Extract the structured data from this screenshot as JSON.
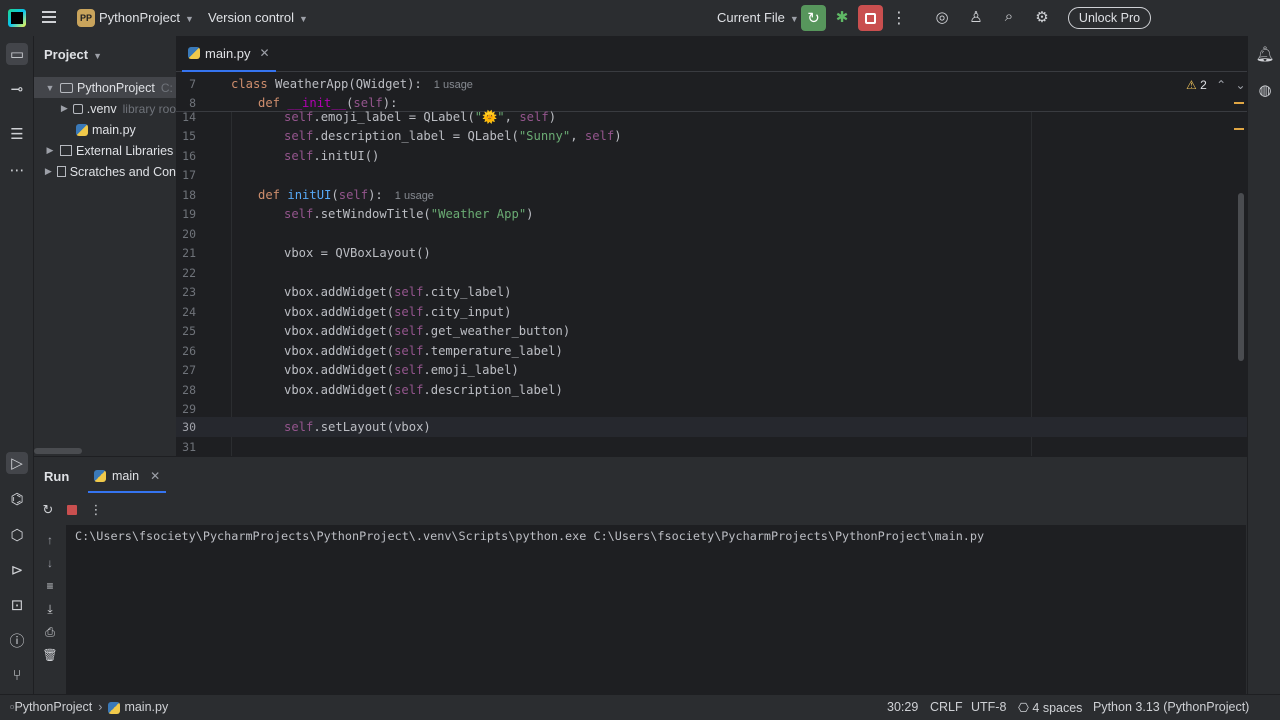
{
  "titlebar": {
    "project_badge": "PP",
    "project_name": "PythonProject",
    "vcs_label": "Version control",
    "run_config": "Current File",
    "unlock_label": "Unlock Pro"
  },
  "project_panel": {
    "header": "Project",
    "tree": [
      {
        "label": "PythonProject",
        "hint": "C:",
        "type": "folder",
        "expanded": true
      },
      {
        "label": ".venv",
        "hint": "library roo",
        "type": "folder",
        "expanded": false
      },
      {
        "label": "main.py",
        "hint": "",
        "type": "python"
      },
      {
        "label": "External Libraries",
        "hint": "",
        "type": "library"
      },
      {
        "label": "Scratches and Con",
        "hint": "",
        "type": "scratch"
      }
    ]
  },
  "editor": {
    "tab_label": "main.py",
    "warning_count": "2",
    "sticky": [
      {
        "num": "7",
        "text": "class WeatherApp(QWidget):",
        "usage": "1 usage"
      },
      {
        "num": "8",
        "text": "    def __init__(self):",
        "usage": ""
      }
    ],
    "lines": [
      {
        "num": "14",
        "text": "        self.emoji_label = QLabel(\"🌞\", self)"
      },
      {
        "num": "15",
        "text": "        self.description_label = QLabel(\"Sunny\", self)"
      },
      {
        "num": "16",
        "text": "        self.initUI()"
      },
      {
        "num": "17",
        "text": ""
      },
      {
        "num": "18",
        "text": "    def initUI(self):",
        "usage": "1 usage"
      },
      {
        "num": "19",
        "text": "        self.setWindowTitle(\"Weather App\")"
      },
      {
        "num": "20",
        "text": ""
      },
      {
        "num": "21",
        "text": "        vbox = QVBoxLayout()"
      },
      {
        "num": "22",
        "text": ""
      },
      {
        "num": "23",
        "text": "        vbox.addWidget(self.city_label)"
      },
      {
        "num": "24",
        "text": "        vbox.addWidget(self.city_input)"
      },
      {
        "num": "25",
        "text": "        vbox.addWidget(self.get_weather_button)"
      },
      {
        "num": "26",
        "text": "        vbox.addWidget(self.temperature_label)"
      },
      {
        "num": "27",
        "text": "        vbox.addWidget(self.emoji_label)"
      },
      {
        "num": "28",
        "text": "        vbox.addWidget(self.description_label)"
      },
      {
        "num": "29",
        "text": ""
      },
      {
        "num": "30",
        "text": "        self.setLayout(vbox)",
        "current": true
      },
      {
        "num": "31",
        "text": ""
      }
    ]
  },
  "run_panel": {
    "title": "Run",
    "tab_label": "main",
    "output": "C:\\Users\\fsociety\\PycharmProjects\\PythonProject\\.venv\\Scripts\\python.exe C:\\Users\\fsociety\\PycharmProjects\\PythonProject\\main.py"
  },
  "statusbar": {
    "breadcrumb_project": "PythonProject",
    "breadcrumb_file": "main.py",
    "position": "30:29",
    "line_sep": "CRLF",
    "encoding": "UTF-8",
    "indent": "4 spaces",
    "interpreter": "Python 3.13 (PythonProject)"
  },
  "colors": {
    "accent": "#3574f0",
    "run_green": "#57965c",
    "stop_red": "#c94f4f",
    "keyword": "#cf8e6d",
    "self": "#94558d",
    "function": "#56a8f5",
    "string": "#6aab73"
  }
}
